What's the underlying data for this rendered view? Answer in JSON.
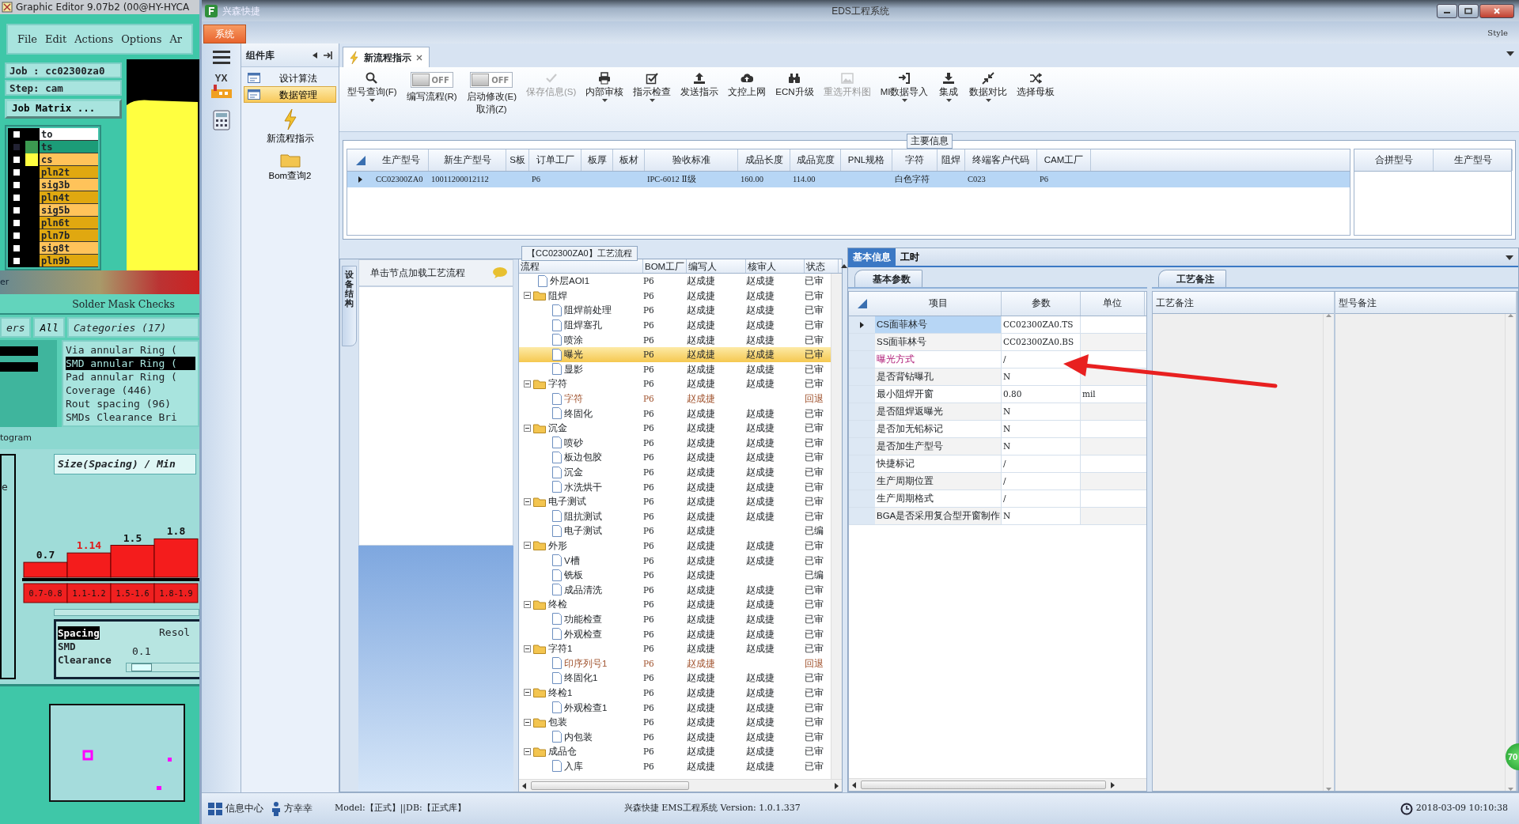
{
  "background_app": {
    "title": "Graphic Editor 9.07b2 (00@HY-HYCA",
    "menu": [
      "File",
      "Edit",
      "Actions",
      "Options",
      "Ar"
    ],
    "job": "Job : cc02300za0",
    "step": "Step: cam",
    "job_matrix_button": "Job Matrix ...",
    "layers": [
      {
        "name": "to",
        "kind": "silk_screen",
        "selected": false
      },
      {
        "name": "ts",
        "kind": "solder_mask",
        "color": "#3c9a50",
        "selected": true
      },
      {
        "name": "cs",
        "kind": "signal",
        "color": "#ffff40",
        "selected": false
      },
      {
        "name": "pln2t",
        "kind": "plane",
        "selected": false
      },
      {
        "name": "sig3b",
        "kind": "signal",
        "selected": false
      },
      {
        "name": "pln4t",
        "kind": "plane",
        "selected": false
      },
      {
        "name": "sig5b",
        "kind": "signal",
        "selected": false
      },
      {
        "name": "pln6t",
        "kind": "plane",
        "selected": false
      },
      {
        "name": "pln7b",
        "kind": "plane",
        "selected": false
      },
      {
        "name": "sig8t",
        "kind": "signal",
        "selected": false
      },
      {
        "name": "pln9b",
        "kind": "plane",
        "selected": false
      }
    ],
    "blurred_label": "er",
    "checks_title": "Solder Mask Checks",
    "filter_tab": "ers",
    "all_button": "All",
    "categories_title": "Categories (17)",
    "categories": [
      {
        "label": "Via annular Ring (",
        "selected": false
      },
      {
        "label": "SMD annular Ring (",
        "selected": true
      },
      {
        "label": "Pad annular Ring (",
        "selected": false
      },
      {
        "label": "Coverage (446)",
        "selected": false
      },
      {
        "label": "Rout spacing (96)",
        "selected": false
      },
      {
        "label": "SMDs Clearance Bri",
        "selected": false
      }
    ],
    "histogram_tab": "togram",
    "side_label": "e",
    "histogram_title": "Size(Spacing) / Min",
    "chart_data": {
      "type": "bar",
      "categories": [
        "0.7-0.8",
        "1.1-1.2",
        "1.5-1.6",
        "1.8-1.9"
      ],
      "values": [
        0.7,
        1.14,
        1.5,
        1.8
      ],
      "data_labels": true
    },
    "check_types": [
      {
        "label": "Spacing",
        "selected": true
      },
      {
        "label": "SMD",
        "selected": false
      },
      {
        "label": "Clearance",
        "selected": false
      }
    ],
    "resolution_label": "Resol",
    "resolution_value": "0.1",
    "resolution_slider": {
      "level": 0.05
    }
  },
  "window": {
    "title": "EDS工程系统",
    "app_name": "兴森快捷"
  },
  "ribbon_tab": "系统",
  "style_label": "Style",
  "nav_logo": "YX",
  "component_panel": {
    "title": "组件库",
    "items": [
      {
        "label": "设计算法",
        "selected": false
      },
      {
        "label": "数据管理",
        "selected": true
      }
    ],
    "tools": [
      "新流程指示",
      "Bom查询2"
    ]
  },
  "doc_tab": "新流程指示",
  "toolbar": [
    {
      "kind": "button",
      "label": "型号查询(F)",
      "disabled": false,
      "dropdown": true
    },
    {
      "kind": "toggle",
      "label": "编写流程(R)",
      "toggle_text": "OFF",
      "on": false
    },
    {
      "kind": "toggle",
      "label": "启动修改(E)",
      "sublabel": "取消(Z)",
      "toggle_text": "OFF",
      "on": false
    },
    {
      "kind": "button",
      "label": "保存信息(S)",
      "disabled": true,
      "dropdown": false
    },
    {
      "kind": "button",
      "label": "内部审核",
      "disabled": false,
      "dropdown": true
    },
    {
      "kind": "button",
      "label": "指示检查",
      "disabled": false,
      "dropdown": true
    },
    {
      "kind": "button",
      "label": "发送指示",
      "disabled": false,
      "dropdown": false
    },
    {
      "kind": "button",
      "label": "文控上网",
      "disabled": false,
      "dropdown": false
    },
    {
      "kind": "button",
      "label": "ECN升级",
      "disabled": false,
      "dropdown": false
    },
    {
      "kind": "button",
      "label": "重选开料图",
      "disabled": true,
      "dropdown": false
    },
    {
      "kind": "button",
      "label": "MI数据导入",
      "disabled": false,
      "dropdown": true
    },
    {
      "kind": "button",
      "label": "集成",
      "disabled": false,
      "dropdown": true
    },
    {
      "kind": "button",
      "label": "数据对比",
      "disabled": false,
      "dropdown": true
    },
    {
      "kind": "button",
      "label": "选择母板",
      "disabled": false,
      "dropdown": false
    }
  ],
  "main_info": {
    "title": "主要信息",
    "columns": [
      "生产型号",
      "新生产型号",
      "S板",
      "订单工厂",
      "板厚",
      "板材",
      "验收标准",
      "成品长度",
      "成品宽度",
      "PNL规格",
      "字符",
      "阻焊",
      "终端客户代码",
      "CAM工厂"
    ],
    "rows": [
      {
        "selected": true,
        "cells": [
          "CC02300ZA0",
          "10011200012112",
          null,
          "P6",
          null,
          null,
          "IPC-6012 Ⅱ级",
          "160.00",
          "114.00",
          null,
          "白色字符",
          null,
          "C023",
          "P6"
        ]
      }
    ],
    "side_columns": [
      "合拼型号",
      "生产型号"
    ]
  },
  "flow_panel": {
    "side_tab": "设备结构",
    "hint": "单击节点加载工艺流程"
  },
  "process_flow": {
    "title": "【CC02300ZA0】工艺流程",
    "columns": [
      "流程",
      "BOM工厂",
      "编写人",
      "核审人",
      "状态"
    ],
    "items": [
      {
        "kind": "file",
        "name": "外层AOI1",
        "bom": "P6",
        "writer": "赵成捷",
        "reviewer": "赵成捷",
        "status": "已审",
        "selected": false,
        "flagged": false
      },
      {
        "kind": "folder",
        "name": "阻焊",
        "bom": "P6",
        "writer": "赵成捷",
        "reviewer": "赵成捷",
        "status": "已审",
        "selected": false,
        "flagged": false,
        "expanded": true,
        "children": [
          {
            "kind": "file",
            "name": "阻焊前处理",
            "bom": "P6",
            "writer": "赵成捷",
            "reviewer": "赵成捷",
            "status": "已审",
            "selected": false,
            "flagged": false
          },
          {
            "kind": "file",
            "name": "阻焊塞孔",
            "bom": "P6",
            "writer": "赵成捷",
            "reviewer": "赵成捷",
            "status": "已审",
            "selected": false,
            "flagged": false
          },
          {
            "kind": "file",
            "name": "喷涂",
            "bom": "P6",
            "writer": "赵成捷",
            "reviewer": "赵成捷",
            "status": "已审",
            "selected": false,
            "flagged": false
          },
          {
            "kind": "file",
            "name": "曝光",
            "bom": "P6",
            "writer": "赵成捷",
            "reviewer": "赵成捷",
            "status": "已审",
            "selected": true,
            "flagged": false
          },
          {
            "kind": "file",
            "name": "显影",
            "bom": "P6",
            "writer": "赵成捷",
            "reviewer": "赵成捷",
            "status": "已审",
            "selected": false,
            "flagged": false
          }
        ]
      },
      {
        "kind": "folder",
        "name": "字符",
        "bom": "P6",
        "writer": "赵成捷",
        "reviewer": "赵成捷",
        "status": "已审",
        "selected": false,
        "flagged": false,
        "expanded": true,
        "children": [
          {
            "kind": "file",
            "name": "字符",
            "bom": "P6",
            "writer": "赵成捷",
            "status": "回退",
            "selected": false,
            "flagged": true
          },
          {
            "kind": "file",
            "name": "终固化",
            "bom": "P6",
            "writer": "赵成捷",
            "reviewer": "赵成捷",
            "status": "已审",
            "selected": false,
            "flagged": false
          }
        ]
      },
      {
        "kind": "folder",
        "name": "沉金",
        "bom": "P6",
        "writer": "赵成捷",
        "reviewer": "赵成捷",
        "status": "已审",
        "selected": false,
        "flagged": false,
        "expanded": true,
        "children": [
          {
            "kind": "file",
            "name": "喷砂",
            "bom": "P6",
            "writer": "赵成捷",
            "reviewer": "赵成捷",
            "status": "已审",
            "selected": false,
            "flagged": false
          },
          {
            "kind": "file",
            "name": "板边包胶",
            "bom": "P6",
            "writer": "赵成捷",
            "reviewer": "赵成捷",
            "status": "已审",
            "selected": false,
            "flagged": false
          },
          {
            "kind": "file",
            "name": "沉金",
            "bom": "P6",
            "writer": "赵成捷",
            "reviewer": "赵成捷",
            "status": "已审",
            "selected": false,
            "flagged": false
          },
          {
            "kind": "file",
            "name": "水洗烘干",
            "bom": "P6",
            "writer": "赵成捷",
            "reviewer": "赵成捷",
            "status": "已审",
            "selected": false,
            "flagged": false
          }
        ]
      },
      {
        "kind": "folder",
        "name": "电子测试",
        "bom": "P6",
        "writer": "赵成捷",
        "reviewer": "赵成捷",
        "status": "已审",
        "selected": false,
        "flagged": false,
        "expanded": true,
        "children": [
          {
            "kind": "file",
            "name": "阻抗测试",
            "bom": "P6",
            "writer": "赵成捷",
            "reviewer": "赵成捷",
            "status": "已审",
            "selected": false,
            "flagged": false
          },
          {
            "kind": "file",
            "name": "电子测试",
            "bom": "P6",
            "writer": "赵成捷",
            "status": "已编",
            "selected": false,
            "flagged": false
          }
        ]
      },
      {
        "kind": "folder",
        "name": "外形",
        "bom": "P6",
        "writer": "赵成捷",
        "reviewer": "赵成捷",
        "status": "已审",
        "selected": false,
        "flagged": false,
        "expanded": true,
        "children": [
          {
            "kind": "file",
            "name": "V槽",
            "bom": "P6",
            "writer": "赵成捷",
            "reviewer": "赵成捷",
            "status": "已审",
            "selected": false,
            "flagged": false
          },
          {
            "kind": "file",
            "name": "铣板",
            "bom": "P6",
            "writer": "赵成捷",
            "status": "已编",
            "selected": false,
            "flagged": false
          },
          {
            "kind": "file",
            "name": "成品清洗",
            "bom": "P6",
            "writer": "赵成捷",
            "reviewer": "赵成捷",
            "status": "已审",
            "selected": false,
            "flagged": false
          }
        ]
      },
      {
        "kind": "folder",
        "name": "终检",
        "bom": "P6",
        "writer": "赵成捷",
        "reviewer": "赵成捷",
        "status": "已审",
        "selected": false,
        "flagged": false,
        "expanded": true,
        "children": [
          {
            "kind": "file",
            "name": "功能检查",
            "bom": "P6",
            "writer": "赵成捷",
            "reviewer": "赵成捷",
            "status": "已审",
            "selected": false,
            "flagged": false
          },
          {
            "kind": "file",
            "name": "外观检查",
            "bom": "P6",
            "writer": "赵成捷",
            "reviewer": "赵成捷",
            "status": "已审",
            "selected": false,
            "flagged": false
          }
        ]
      },
      {
        "kind": "folder",
        "name": "字符1",
        "bom": "P6",
        "writer": "赵成捷",
        "reviewer": "赵成捷",
        "status": "已审",
        "selected": false,
        "flagged": false,
        "expanded": true,
        "children": [
          {
            "kind": "file",
            "name": "印序列号1",
            "bom": "P6",
            "writer": "赵成捷",
            "status": "回退",
            "selected": false,
            "flagged": true
          },
          {
            "kind": "file",
            "name": "终固化1",
            "bom": "P6",
            "writer": "赵成捷",
            "reviewer": "赵成捷",
            "status": "已审",
            "selected": false,
            "flagged": false
          }
        ]
      },
      {
        "kind": "folder",
        "name": "终检1",
        "bom": "P6",
        "writer": "赵成捷",
        "reviewer": "赵成捷",
        "status": "已审",
        "selected": false,
        "flagged": false,
        "expanded": true,
        "children": [
          {
            "kind": "file",
            "name": "外观检查1",
            "bom": "P6",
            "writer": "赵成捷",
            "reviewer": "赵成捷",
            "status": "已审",
            "selected": false,
            "flagged": false
          }
        ]
      },
      {
        "kind": "folder",
        "name": "包装",
        "bom": "P6",
        "writer": "赵成捷",
        "reviewer": "赵成捷",
        "status": "已审",
        "selected": false,
        "flagged": false,
        "expanded": true,
        "children": [
          {
            "kind": "file",
            "name": "内包装",
            "bom": "P6",
            "writer": "赵成捷",
            "reviewer": "赵成捷",
            "status": "已审",
            "selected": false,
            "flagged": false
          }
        ]
      },
      {
        "kind": "folder",
        "name": "成品仓",
        "bom": "P6",
        "writer": "赵成捷",
        "reviewer": "赵成捷",
        "status": "已审",
        "selected": false,
        "flagged": false,
        "expanded": true,
        "children": [
          {
            "kind": "file",
            "name": "入库",
            "bom": "P6",
            "writer": "赵成捷",
            "reviewer": "赵成捷",
            "status": "已审",
            "selected": false,
            "flagged": false
          }
        ]
      }
    ]
  },
  "detail_tabs": [
    {
      "label": "基本信息",
      "selected": true
    },
    {
      "label": "工时",
      "selected": false
    }
  ],
  "params": {
    "tab": "基本参数",
    "columns": [
      "项目",
      "参数",
      "单位"
    ],
    "rows": [
      {
        "item": "CS面菲林号",
        "value": "CC02300ZA0.TS",
        "selected": true,
        "highlighted": false
      },
      {
        "item": "SS面菲林号",
        "value": "CC02300ZA0.BS",
        "selected": false,
        "highlighted": false
      },
      {
        "item": "曝光方式",
        "value": "/",
        "selected": false,
        "highlighted": true
      },
      {
        "item": "是否背钻曝孔",
        "value": "N",
        "selected": false,
        "highlighted": false
      },
      {
        "item": "最小阻焊开窗",
        "value": "0.80",
        "unit": "mil",
        "selected": false,
        "highlighted": false
      },
      {
        "item": "是否阻焊返曝光",
        "value": "N",
        "selected": false,
        "highlighted": false
      },
      {
        "item": "是否加无铅标记",
        "value": "N",
        "selected": false,
        "highlighted": false
      },
      {
        "item": "是否加生产型号",
        "value": "N",
        "selected": false,
        "highlighted": false
      },
      {
        "item": "快捷标记",
        "value": "/",
        "selected": false,
        "highlighted": false
      },
      {
        "item": "生产周期位置",
        "value": "/",
        "selected": false,
        "highlighted": false
      },
      {
        "item": "生产周期格式",
        "value": "/",
        "selected": false,
        "highlighted": false
      },
      {
        "item": "BGA是否采用复合型开窗制作",
        "value": "N",
        "selected": false,
        "highlighted": false
      }
    ]
  },
  "notes": {
    "tab": "工艺备注",
    "columns": [
      "工艺备注",
      "型号备注"
    ]
  },
  "float_badge": "70",
  "status_bar": {
    "info_center": "信息中心",
    "user": "方幸幸",
    "model": "Model:【正式】||DB:【正式库】",
    "version": "兴森快捷  EMS工程系统  Version: 1.0.1.337",
    "datetime": "2018-03-09 10:10:38"
  }
}
